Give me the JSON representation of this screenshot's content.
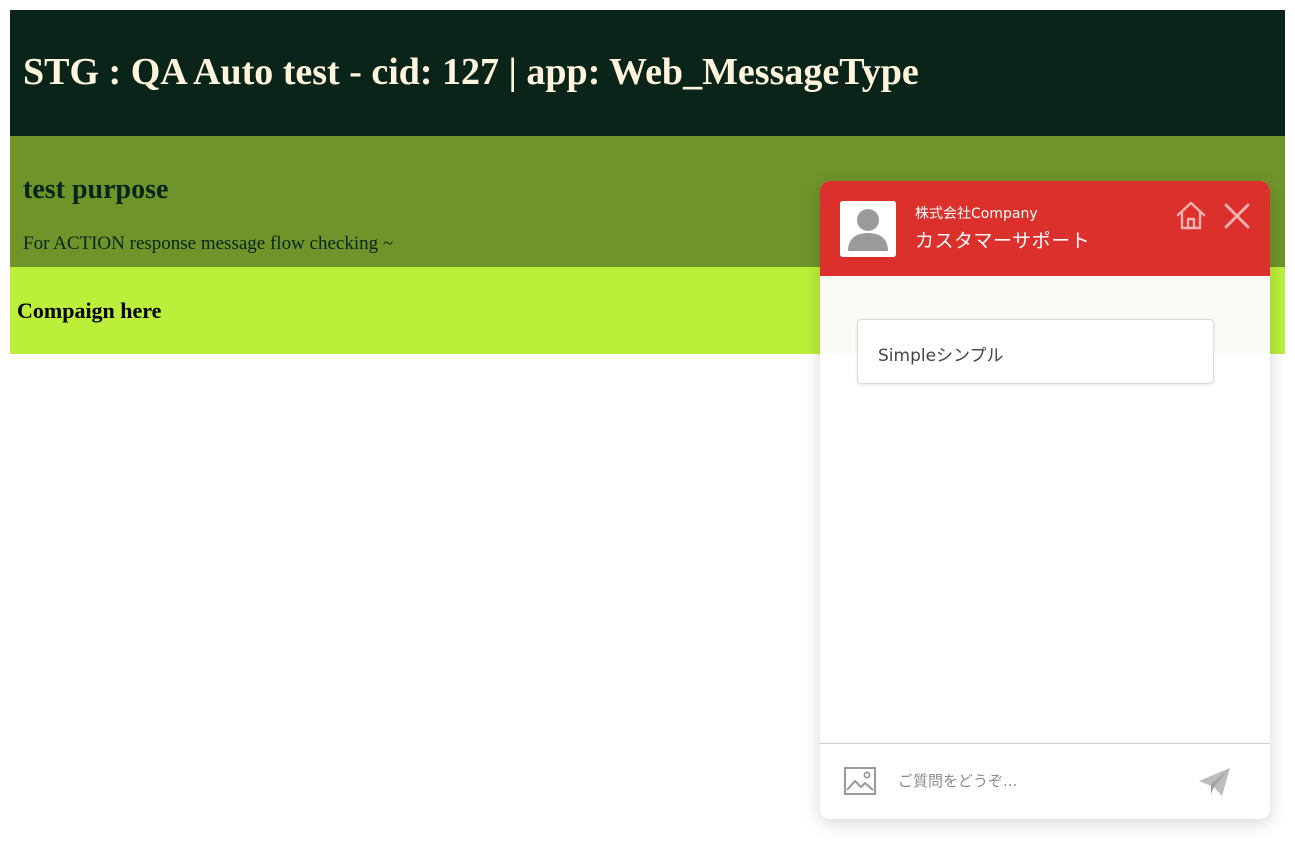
{
  "page": {
    "header_title": "STG : QA Auto test - cid: 127 | app: Web_MessageType",
    "purpose_title": "test purpose",
    "purpose_text": "For ACTION response message flow checking ~",
    "campaign_text": "Compaign here"
  },
  "chat": {
    "company_name": "株式会社Company",
    "support_name": "カスタマーサポート",
    "accent_color": "#dc302c",
    "header_icons": [
      "home-icon",
      "close-icon"
    ],
    "messages": [
      {
        "text": "Simpleシンプル"
      }
    ],
    "input_placeholder": "ご質問をどうぞ...",
    "footer_icons": [
      "image-icon",
      "send-icon"
    ]
  }
}
